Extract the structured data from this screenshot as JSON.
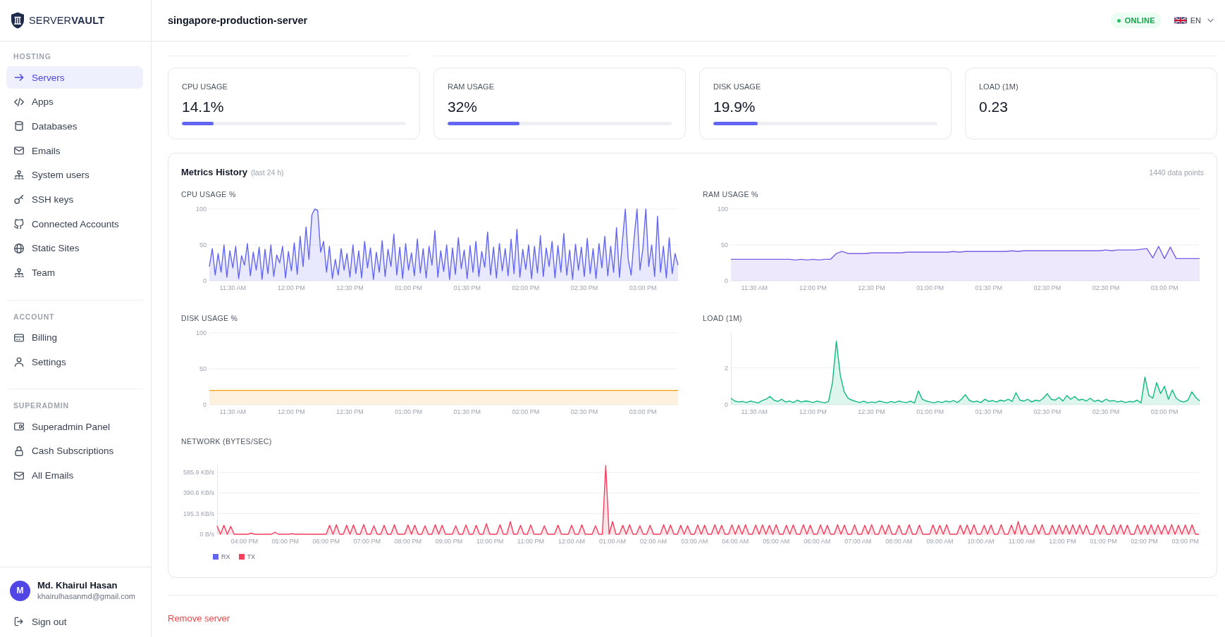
{
  "sidebar": {
    "logo": "SERVER**VAULT**",
    "sections": [
      {
        "heading": "HOSTING",
        "items": [
          {
            "label": "Servers",
            "selected": true
          },
          {
            "label": "Apps",
            "selected": false
          },
          {
            "label": "Databases",
            "selected": false
          },
          {
            "label": "Emails",
            "selected": false
          },
          {
            "label": "System users",
            "selected": false
          },
          {
            "label": "SSH keys",
            "selected": false
          },
          {
            "label": "Connected Accounts",
            "selected": false
          },
          {
            "label": "Static Sites",
            "selected": false
          },
          {
            "label": "Team",
            "selected": false
          }
        ]
      },
      {
        "heading": "ACCOUNT",
        "items": [
          {
            "label": "Billing",
            "selected": false
          },
          {
            "label": "Settings",
            "selected": false
          }
        ]
      },
      {
        "heading": "SUPERADMIN",
        "items": [
          {
            "label": "Superadmin Panel",
            "selected": false
          },
          {
            "label": "Cash Subscriptions",
            "selected": false
          },
          {
            "label": "All Emails",
            "selected": false
          }
        ]
      }
    ],
    "user": {
      "initial": "M",
      "name": "Md. Khairul Hasan",
      "email": "khairulhasanmd@gmail.com"
    },
    "sign_out": "Sign out"
  },
  "header": {
    "title": "singapore-production-server",
    "status": "ONLINE",
    "language": "EN"
  },
  "stats": [
    {
      "label": "CPU USAGE",
      "value": "14.1%",
      "level": 0.141
    },
    {
      "label": "RAM USAGE",
      "value": "32%",
      "level": 0.32
    },
    {
      "label": "DISK USAGE",
      "value": "19.9%",
      "level": 0.199
    },
    {
      "label": "LOAD (1M)",
      "value": "0.23"
    }
  ],
  "metrics": {
    "title": "Metrics History",
    "subtitle": "(last 24 h)",
    "count": "1440 data points",
    "charts": [
      {
        "chart_data": {
          "type": "area",
          "title": "CPU USAGE %",
          "grid": true,
          "categories": [
            null,
            null,
            null,
            null,
            null,
            null,
            null,
            null,
            "11:30 AM",
            null,
            null,
            null,
            null,
            null,
            null,
            null,
            null,
            null,
            null,
            null,
            null,
            null,
            null,
            null,
            null,
            null,
            null,
            null,
            "12:00 PM",
            null,
            null,
            null,
            null,
            null,
            null,
            null,
            null,
            null,
            null,
            null,
            null,
            null,
            null,
            null,
            null,
            null,
            null,
            null,
            "12:30 PM",
            null,
            null,
            null,
            null,
            null,
            null,
            null,
            null,
            null,
            null,
            null,
            null,
            null,
            null,
            null,
            null,
            null,
            null,
            null,
            "01:00 PM",
            null,
            null,
            null,
            null,
            null,
            null,
            null,
            null,
            null,
            null,
            null,
            null,
            null,
            null,
            null,
            null,
            null,
            null,
            null,
            "01:30 PM",
            null,
            null,
            null,
            null,
            null,
            null,
            null,
            null,
            null,
            null,
            null,
            null,
            null,
            null,
            null,
            null,
            null,
            null,
            null,
            "02:00 PM",
            null,
            null,
            null,
            null,
            null,
            null,
            null,
            null,
            null,
            null,
            null,
            null,
            null,
            null,
            null,
            null,
            null,
            null,
            null,
            "02:30 PM",
            null,
            null,
            null,
            null,
            null,
            null,
            null,
            null,
            null,
            null,
            null,
            null,
            null,
            null,
            null,
            null,
            null,
            null,
            null,
            "03:00 PM",
            null,
            null,
            null,
            null,
            null,
            null,
            null,
            null,
            null,
            null,
            null,
            null
          ],
          "ylim": [
            0,
            100
          ],
          "yticks": [
            0,
            50,
            100
          ],
          "series": [
            {
              "color": "#6366f1",
              "values": [
                20,
                45,
                8,
                38,
                12,
                50,
                5,
                42,
                18,
                48,
                3,
                35,
                22,
                52,
                7,
                40,
                15,
                47,
                2,
                44,
                10,
                50,
                6,
                36,
                25,
                48,
                4,
                41,
                14,
                53,
                9,
                62,
                20,
                75,
                30,
                92,
                100,
                98,
                40,
                55,
                12,
                48,
                3,
                30,
                8,
                45,
                15,
                38,
                5,
                50,
                10,
                42,
                4,
                55,
                18,
                46,
                2,
                40,
                12,
                56,
                6,
                44,
                20,
                65,
                8,
                47,
                3,
                52,
                15,
                39,
                7,
                58,
                11,
                45,
                4,
                48,
                22,
                70,
                5,
                42,
                13,
                50,
                2,
                46,
                9,
                60,
                17,
                43,
                3,
                49,
                12,
                55,
                6,
                41,
                19,
                68,
                8,
                47,
                4,
                52,
                14,
                45,
                7,
                58,
                10,
                72,
                5,
                44,
                16,
                50,
                3,
                48,
                11,
                63,
                6,
                46,
                20,
                55,
                4,
                49,
                12,
                66,
                8,
                43,
                2,
                51,
                15,
                47,
                6,
                59,
                10,
                45,
                3,
                52,
                18,
                62,
                7,
                48,
                12,
                74,
                5,
                55,
                100,
                30,
                8,
                60,
                100,
                15,
                45,
                100,
                20,
                50,
                6,
                90,
                12,
                48,
                4,
                60,
                10,
                38,
                22
              ]
            }
          ]
        }
      },
      {
        "chart_data": {
          "type": "area",
          "title": "RAM USAGE %",
          "grid": true,
          "categories": [
            null,
            null,
            null,
            null,
            "11:30 AM",
            null,
            null,
            null,
            null,
            null,
            null,
            null,
            null,
            null,
            "12:00 PM",
            null,
            null,
            null,
            null,
            null,
            null,
            null,
            null,
            null,
            "12:30 PM",
            null,
            null,
            null,
            null,
            null,
            null,
            null,
            null,
            null,
            "01:00 PM",
            null,
            null,
            null,
            null,
            null,
            null,
            null,
            null,
            null,
            "01:30 PM",
            null,
            null,
            null,
            null,
            null,
            null,
            null,
            null,
            null,
            "02:30 PM",
            null,
            null,
            null,
            null,
            null,
            null,
            null,
            null,
            null,
            "02:30 PM",
            null,
            null,
            null,
            null,
            null,
            null,
            null,
            null,
            null,
            "03:00 PM",
            null,
            null,
            null,
            null,
            null,
            null
          ],
          "ylim": [
            0,
            100
          ],
          "yticks": [
            0,
            50,
            100
          ],
          "series": [
            {
              "color": "#7c5ce6",
              "values": [
                30,
                30,
                30,
                30,
                30,
                30,
                30,
                30,
                30,
                30,
                30,
                29,
                30,
                29,
                30,
                29,
                30,
                30,
                38,
                41,
                38,
                38,
                38,
                38,
                39,
                39,
                39,
                39,
                39,
                39,
                40,
                40,
                40,
                40,
                40,
                40,
                40,
                40,
                41,
                40,
                41,
                41,
                41,
                41,
                41,
                41,
                41,
                41,
                42,
                41,
                42,
                42,
                42,
                42,
                42,
                42,
                42,
                42,
                42,
                42,
                42,
                42,
                42,
                42,
                43,
                42,
                43,
                43,
                43,
                43,
                44,
                45,
                32,
                48,
                31,
                47,
                31,
                31,
                31,
                31,
                31
              ]
            }
          ]
        }
      },
      {
        "chart_data": {
          "type": "area",
          "title": "DISK USAGE %",
          "grid": true,
          "categories": [
            null,
            null,
            "11:30 AM",
            null,
            null,
            null,
            null,
            "12:00 PM",
            null,
            null,
            null,
            null,
            "12:30 PM",
            null,
            null,
            null,
            null,
            "01:00 PM",
            null,
            null,
            null,
            null,
            "01:30 PM",
            null,
            null,
            null,
            null,
            "02:00 PM",
            null,
            null,
            null,
            null,
            "02:30 PM",
            null,
            null,
            null,
            null,
            "03:00 PM",
            null,
            null,
            null
          ],
          "ylim": [
            0,
            100
          ],
          "yticks": [
            0,
            50,
            100
          ],
          "series": [
            {
              "color": "#f59e0b",
              "values": [
                20,
                20,
                20,
                20,
                20,
                20,
                20,
                20,
                20,
                20,
                20,
                20,
                20,
                20,
                20,
                20,
                20,
                20,
                20,
                20,
                20,
                20,
                20,
                20,
                20,
                20,
                20,
                20,
                20,
                20,
                20,
                20,
                20,
                20,
                20,
                20,
                20,
                20,
                20,
                20,
                20
              ]
            }
          ]
        }
      },
      {
        "chart_data": {
          "type": "area",
          "title": "LOAD (1M)",
          "grid": true,
          "categories": [
            null,
            null,
            null,
            null,
            null,
            null,
            "11:30 AM",
            null,
            null,
            null,
            null,
            null,
            null,
            null,
            null,
            null,
            null,
            null,
            null,
            null,
            null,
            "12:00 PM",
            null,
            null,
            null,
            null,
            null,
            null,
            null,
            null,
            null,
            null,
            null,
            null,
            null,
            null,
            "12:30 PM",
            null,
            null,
            null,
            null,
            null,
            null,
            null,
            null,
            null,
            null,
            null,
            null,
            null,
            null,
            "01:00 PM",
            null,
            null,
            null,
            null,
            null,
            null,
            null,
            null,
            null,
            null,
            null,
            null,
            null,
            null,
            "01:30 PM",
            null,
            null,
            null,
            null,
            null,
            null,
            null,
            null,
            null,
            null,
            null,
            null,
            null,
            null,
            "02:30 PM",
            null,
            null,
            null,
            null,
            null,
            null,
            null,
            null,
            null,
            null,
            null,
            null,
            null,
            null,
            "02:30 PM",
            null,
            null,
            null,
            null,
            null,
            null,
            null,
            null,
            null,
            null,
            null,
            null,
            null,
            null,
            "03:00 PM",
            null,
            null,
            null,
            null,
            null,
            null,
            null,
            null,
            null
          ],
          "ylim": [
            0,
            3.9
          ],
          "yticks": [
            0,
            2
          ],
          "series": [
            {
              "color": "#10b981",
              "values": [
                0.35,
                0.2,
                0.15,
                0.18,
                0.12,
                0.2,
                0.15,
                0.1,
                0.22,
                0.3,
                0.45,
                0.25,
                0.18,
                0.3,
                0.15,
                0.2,
                0.12,
                0.25,
                0.15,
                0.2,
                0.18,
                0.12,
                0.2,
                0.15,
                0.1,
                0.18,
                1.2,
                3.45,
                1.6,
                0.7,
                0.35,
                0.25,
                0.18,
                0.12,
                0.2,
                0.1,
                0.15,
                0.12,
                0.2,
                0.15,
                0.1,
                0.18,
                0.12,
                0.2,
                0.15,
                0.12,
                0.2,
                0.1,
                0.75,
                0.3,
                0.2,
                0.15,
                0.1,
                0.18,
                0.12,
                0.2,
                0.15,
                0.22,
                0.12,
                0.3,
                0.55,
                0.25,
                0.15,
                0.2,
                0.12,
                0.3,
                0.18,
                0.22,
                0.15,
                0.25,
                0.2,
                0.3,
                0.18,
                0.65,
                0.25,
                0.2,
                0.3,
                0.15,
                0.25,
                0.2,
                0.35,
                0.6,
                0.3,
                0.25,
                0.4,
                0.2,
                0.5,
                0.3,
                0.45,
                0.25,
                0.3,
                0.2,
                0.35,
                0.18,
                0.25,
                0.15,
                0.3,
                0.2,
                0.22,
                0.15,
                0.2,
                0.12,
                0.18,
                0.15,
                0.25,
                0.1,
                1.5,
                0.5,
                0.35,
                1.2,
                0.6,
                1,
                0.3,
                0.8,
                0.35,
                0.2,
                0.15,
                0.25,
                0.7,
                0.4,
                0.2
              ]
            }
          ]
        }
      },
      {
        "chart_data": {
          "type": "area",
          "title": "NETWORK (BYTES/SEC)",
          "grid": true,
          "categories": [
            null,
            null,
            null,
            null,
            null,
            null,
            null,
            null,
            "04:00 PM",
            null,
            null,
            null,
            null,
            null,
            null,
            null,
            null,
            null,
            null,
            null,
            "05:00 PM",
            null,
            null,
            null,
            null,
            null,
            null,
            null,
            null,
            null,
            null,
            null,
            "06:00 PM",
            null,
            null,
            null,
            null,
            null,
            null,
            null,
            null,
            null,
            null,
            null,
            "07:00 PM",
            null,
            null,
            null,
            null,
            null,
            null,
            null,
            null,
            null,
            null,
            null,
            "08:00 PM",
            null,
            null,
            null,
            null,
            null,
            null,
            null,
            null,
            null,
            null,
            null,
            "09:00 PM",
            null,
            null,
            null,
            null,
            null,
            null,
            null,
            null,
            null,
            null,
            null,
            "10:00 PM",
            null,
            null,
            null,
            null,
            null,
            null,
            null,
            null,
            null,
            null,
            null,
            "11:00 PM",
            null,
            null,
            null,
            null,
            null,
            null,
            null,
            null,
            null,
            null,
            null,
            "12:00 AM",
            null,
            null,
            null,
            null,
            null,
            null,
            null,
            null,
            null,
            null,
            null,
            "01:00 AM",
            null,
            null,
            null,
            null,
            null,
            null,
            null,
            null,
            null,
            null,
            null,
            "02:00 AM",
            null,
            null,
            null,
            null,
            null,
            null,
            null,
            null,
            null,
            null,
            null,
            "03:00 AM",
            null,
            null,
            null,
            null,
            null,
            null,
            null,
            null,
            null,
            null,
            null,
            "04:00 AM",
            null,
            null,
            null,
            null,
            null,
            null,
            null,
            null,
            null,
            null,
            null,
            "05:00 AM",
            null,
            null,
            null,
            null,
            null,
            null,
            null,
            null,
            null,
            null,
            null,
            "06:00 AM",
            null,
            null,
            null,
            null,
            null,
            null,
            null,
            null,
            null,
            null,
            null,
            "07:00 AM",
            null,
            null,
            null,
            null,
            null,
            null,
            null,
            null,
            null,
            null,
            null,
            "08:00 AM",
            null,
            null,
            null,
            null,
            null,
            null,
            null,
            null,
            null,
            null,
            null,
            "09:00 AM",
            null,
            null,
            null,
            null,
            null,
            null,
            null,
            null,
            null,
            null,
            null,
            "10:00 AM",
            null,
            null,
            null,
            null,
            null,
            null,
            null,
            null,
            null,
            null,
            null,
            "11:00 AM",
            null,
            null,
            null,
            null,
            null,
            null,
            null,
            null,
            null,
            null,
            null,
            "12:00 PM",
            null,
            null,
            null,
            null,
            null,
            null,
            null,
            null,
            null,
            null,
            null,
            "01:00 PM",
            null,
            null,
            null,
            null,
            null,
            null,
            null,
            null,
            null,
            null,
            null,
            "02:00 PM",
            null,
            null,
            null,
            null,
            null,
            null,
            null,
            null,
            null,
            null,
            null,
            "03:00 PM",
            null,
            null,
            null,
            null
          ],
          "ylim": [
            0,
            660
          ],
          "yticks": [
            {
              "value": 0,
              "label": "0 B/s"
            },
            {
              "value": 195.3,
              "label": "195.3 KB/s"
            },
            {
              "value": 390.6,
              "label": "390.6 KB/s"
            },
            {
              "value": 585.9,
              "label": "585.9 KB/s"
            }
          ],
          "series": [
            {
              "color": "#f43f5e",
              "values": [
                80,
                0,
                85,
                0,
                75,
                0,
                0,
                0,
                0,
                0,
                10,
                0,
                0,
                0,
                0,
                0,
                0,
                20,
                0,
                0,
                0,
                0,
                5,
                0,
                0,
                0,
                0,
                0,
                0,
                0,
                0,
                0,
                0,
                85,
                0,
                90,
                0,
                0,
                85,
                0,
                88,
                0,
                0,
                92,
                0,
                0,
                80,
                0,
                0,
                85,
                0,
                0,
                90,
                0,
                0,
                0,
                88,
                0,
                86,
                0,
                0,
                80,
                0,
                0,
                90,
                0,
                85,
                0,
                0,
                0,
                80,
                0,
                0,
                88,
                0,
                0,
                85,
                0,
                0,
                100,
                0,
                0,
                0,
                90,
                0,
                0,
                120,
                0,
                0,
                85,
                0,
                0,
                88,
                0,
                0,
                0,
                80,
                0,
                0,
                0,
                86,
                0,
                0,
                0,
                85,
                0,
                0,
                90,
                0,
                0,
                0,
                80,
                0,
                0,
                650,
                0,
                120,
                0,
                0,
                85,
                0,
                90,
                0,
                0,
                80,
                0,
                0,
                85,
                0,
                0,
                0,
                90,
                0,
                88,
                0,
                0,
                85,
                0,
                80,
                0,
                0,
                88,
                0,
                86,
                0,
                0,
                90,
                0,
                85,
                0,
                0,
                88,
                0,
                85,
                0,
                90,
                0,
                0,
                86,
                0,
                88,
                0,
                85,
                0,
                90,
                0,
                0,
                85,
                0,
                88,
                0,
                0,
                90,
                0,
                86,
                0,
                0,
                88,
                0,
                85,
                0,
                0,
                90,
                0,
                86,
                0,
                0,
                88,
                0,
                0,
                85,
                0,
                90,
                0,
                0,
                86,
                0,
                88,
                0,
                0,
                85,
                0,
                0,
                90,
                0,
                0,
                86,
                0,
                0,
                0,
                88,
                0,
                85,
                0,
                90,
                0,
                0,
                0,
                86,
                0,
                88,
                0,
                90,
                0,
                0,
                85,
                0,
                88,
                0,
                0,
                90,
                0,
                0,
                86,
                0,
                120,
                0,
                85,
                0,
                0,
                88,
                0,
                90,
                0,
                0,
                86,
                0,
                88,
                0,
                85,
                0,
                90,
                0,
                88,
                0,
                86,
                0,
                0,
                90,
                0,
                85,
                0,
                0,
                88,
                0,
                90,
                0,
                86,
                0,
                0,
                88,
                0,
                85,
                0,
                90,
                0,
                88,
                0,
                86,
                0,
                90,
                0,
                85,
                0,
                88,
                0,
                90,
                0,
                0
              ]
            }
          ]
        },
        "legend": [
          {
            "label": "RX",
            "color": "#6366f1"
          },
          {
            "label": "TX",
            "color": "#f43f5e"
          }
        ]
      }
    ]
  },
  "remove_button": "Remove server"
}
